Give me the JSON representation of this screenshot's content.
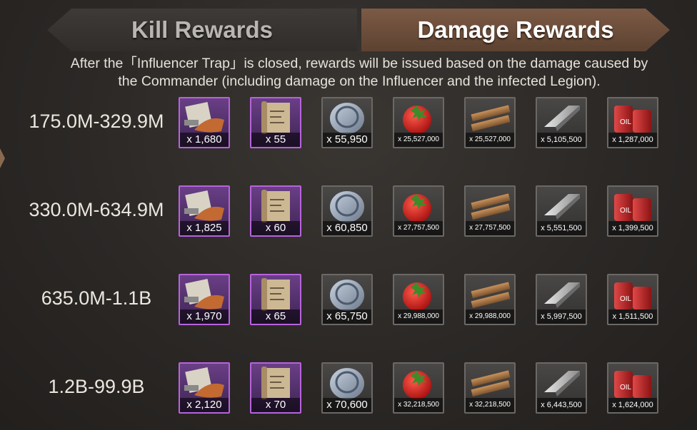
{
  "tabs": {
    "kill_label": "Kill Rewards",
    "damage_label": "Damage Rewards",
    "active": "damage"
  },
  "description_line1": "After the「Influencer Trap」is closed, rewards will be issued based on the damage caused by",
  "description_line2": "the Commander (including damage on the Influencer and the infected Legion).",
  "item_icons": [
    "blueprint-parts-icon",
    "blueprint-scroll-icon",
    "silver-coin-icon",
    "tomato-food-icon",
    "wood-planks-icon",
    "steel-bar-icon",
    "oil-barrel-icon"
  ],
  "colors": {
    "rare_border": "#b763dd",
    "common_border": "#6b6865",
    "active_tab": "#6e4f3b"
  },
  "rows": [
    {
      "range": "175.0M-329.9M",
      "qty": [
        "x 1,680",
        "x 55",
        "x 55,950",
        "x 25,527,000",
        "x 25,527,000",
        "x 5,105,500",
        "x 1,287,000"
      ]
    },
    {
      "range": "330.0M-634.9M",
      "qty": [
        "x 1,825",
        "x 60",
        "x 60,850",
        "x 27,757,500",
        "x 27,757,500",
        "x 5,551,500",
        "x 1,399,500"
      ]
    },
    {
      "range": "635.0M-1.1B",
      "qty": [
        "x 1,970",
        "x 65",
        "x 65,750",
        "x 29,988,000",
        "x 29,988,000",
        "x 5,997,500",
        "x 1,511,500"
      ]
    },
    {
      "range": "1.2B-99.9B",
      "qty": [
        "x 2,120",
        "x 70",
        "x 70,600",
        "x 32,218,500",
        "x 32,218,500",
        "x 6,443,500",
        "x 1,624,000"
      ]
    }
  ]
}
